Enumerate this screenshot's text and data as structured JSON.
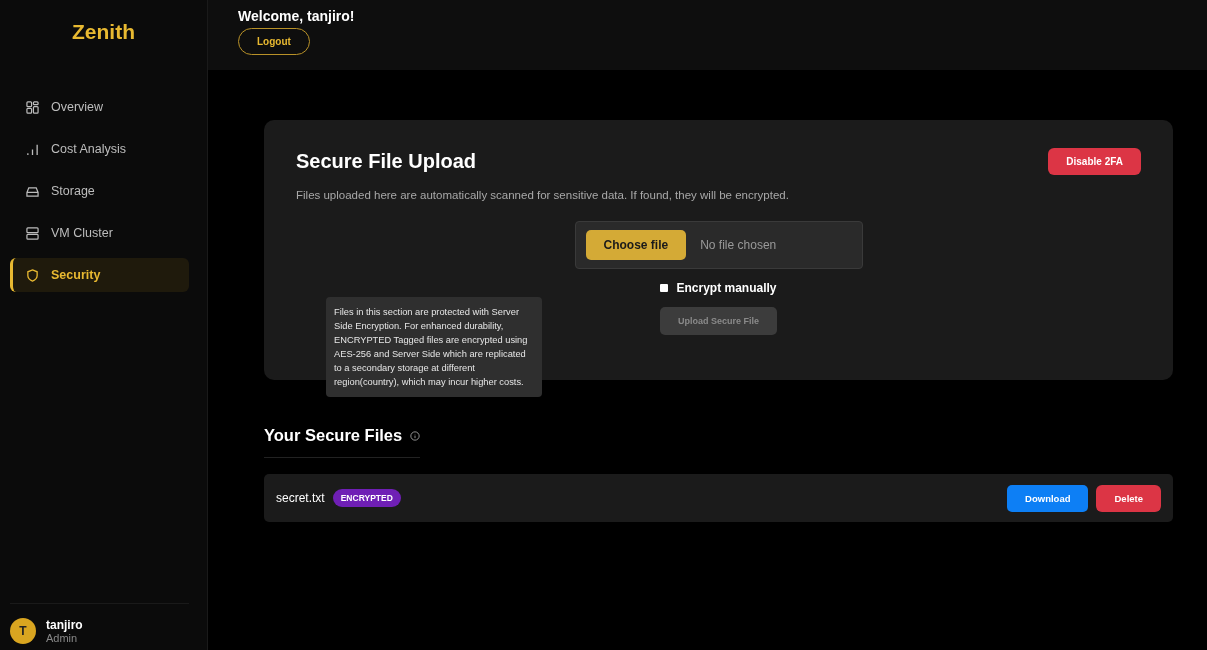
{
  "sidebar": {
    "logo": "Zenith",
    "items": [
      {
        "label": "Overview",
        "selected": false
      },
      {
        "label": "Cost Analysis",
        "selected": false
      },
      {
        "label": "Storage",
        "selected": false
      },
      {
        "label": "VM Cluster",
        "selected": false
      },
      {
        "label": "Security",
        "selected": true
      }
    ],
    "user": {
      "initial": "T",
      "name": "tanjiro",
      "role": "Admin"
    }
  },
  "header": {
    "welcome": "Welcome, tanjiro!",
    "logout": "Logout"
  },
  "upload_card": {
    "title": "Secure File Upload",
    "disable_2fa": "Disable 2FA",
    "description": "Files uploaded here are automatically scanned for sensitive data. If found, they will be encrypted.",
    "choose_file": "Choose file",
    "file_status": "No file chosen",
    "encrypt_manually": {
      "label": "Encrypt manually",
      "checked": false
    },
    "upload_button": {
      "label": "Upload Secure File",
      "disabled": true
    }
  },
  "tooltip": "Files in this section are protected with Server Side Encryption. For enhanced durability, ENCRYPTED Tagged files are encrypted using AES-256 and Server Side which are replicated to a secondary storage at different region(country), which may incur higher costs.",
  "files_section": {
    "title": "Your Secure Files",
    "files": [
      {
        "name": "secret.txt",
        "tag": "ENCRYPTED",
        "download": "Download",
        "delete": "Delete"
      }
    ]
  }
}
